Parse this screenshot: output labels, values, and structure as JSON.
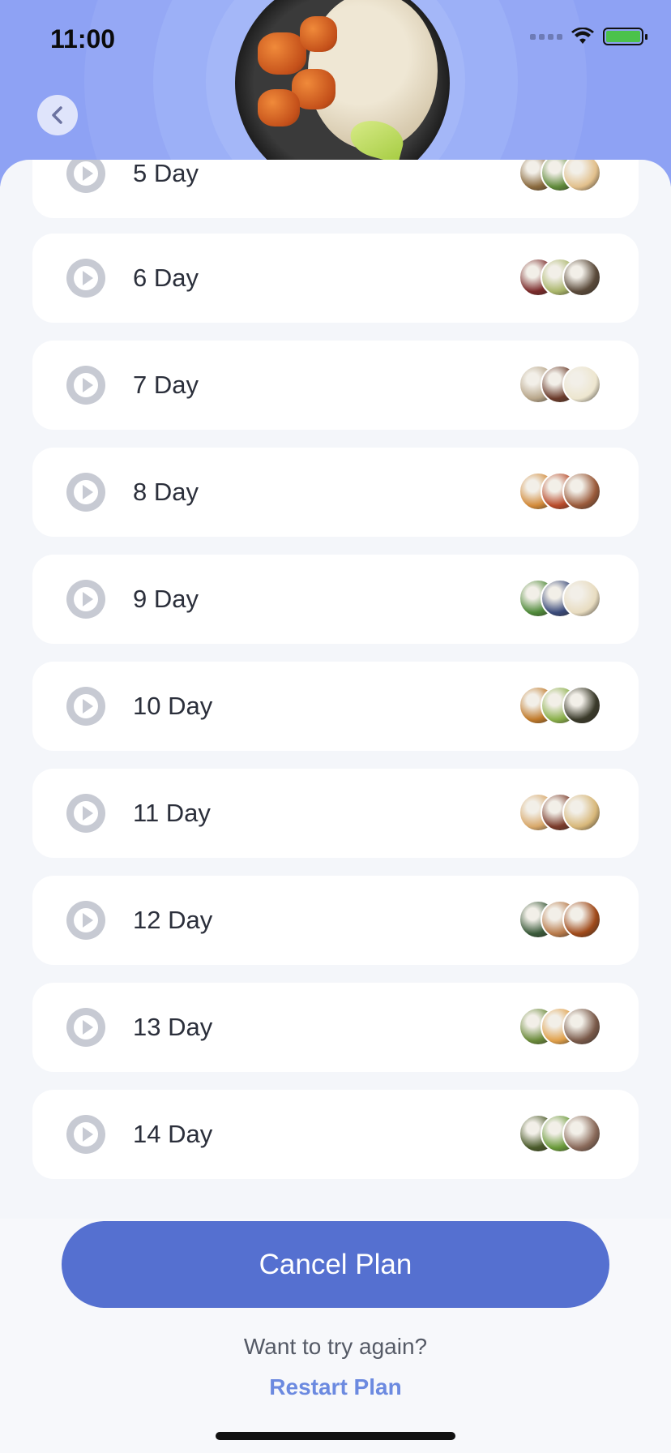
{
  "status_bar": {
    "time": "11:00"
  },
  "header": {
    "back_icon": "chevron-left-icon"
  },
  "days": [
    {
      "label": "5 Day",
      "thumb_colors": [
        "#8a6a3e",
        "#5f8a3a",
        "#e2c08c"
      ]
    },
    {
      "label": "6 Day",
      "thumb_colors": [
        "#7a2a2a",
        "#a9b56a",
        "#5a4a3a"
      ]
    },
    {
      "label": "7 Day",
      "thumb_colors": [
        "#b8a68a",
        "#6a3a2a",
        "#ede6cf"
      ]
    },
    {
      "label": "8 Day",
      "thumb_colors": [
        "#d28a3a",
        "#b84a2a",
        "#9a5a3a"
      ]
    },
    {
      "label": "9 Day",
      "thumb_colors": [
        "#4f8a3a",
        "#3a4a7a",
        "#e8dcc0"
      ]
    },
    {
      "label": "10 Day",
      "thumb_colors": [
        "#c07a2a",
        "#8ab04a",
        "#3a3a2a"
      ]
    },
    {
      "label": "11 Day",
      "thumb_colors": [
        "#d8a86a",
        "#7a3a2a",
        "#d8b87a"
      ]
    },
    {
      "label": "12 Day",
      "thumb_colors": [
        "#3a5a3a",
        "#b87a4a",
        "#a04a1a"
      ]
    },
    {
      "label": "13 Day",
      "thumb_colors": [
        "#6a8a3a",
        "#e0a04a",
        "#7a5a4a"
      ]
    },
    {
      "label": "14 Day",
      "thumb_colors": [
        "#4a5a2a",
        "#6a9a3a",
        "#8a6a5a"
      ]
    }
  ],
  "play_icon": "play-circle-icon",
  "footer": {
    "cancel_label": "Cancel Plan",
    "try_again_text": "Want to try again?",
    "restart_label": "Restart Plan"
  },
  "colors": {
    "header_bg": "#8ea2f4",
    "primary_button": "#5570d0",
    "link": "#6c8ae0"
  }
}
